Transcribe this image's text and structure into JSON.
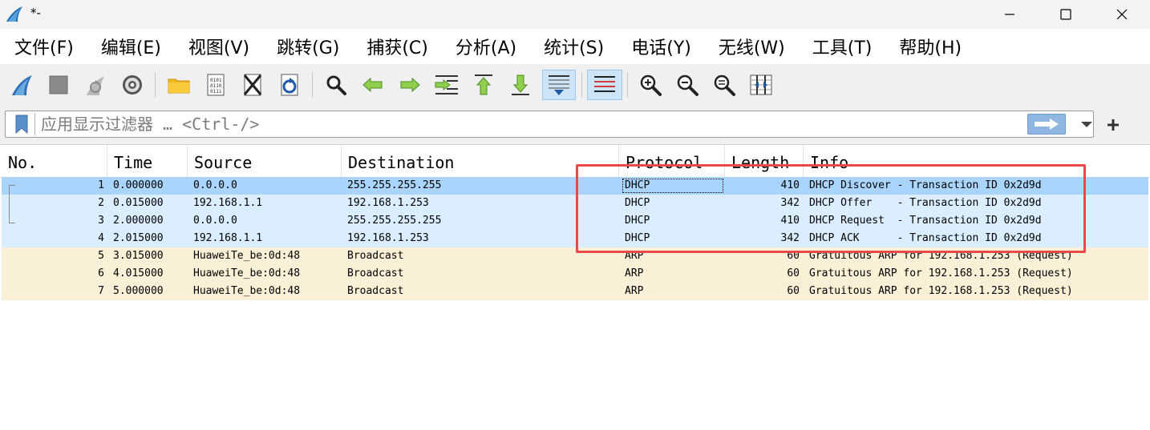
{
  "window": {
    "title": "*-"
  },
  "menu": [
    "文件(F)",
    "编辑(E)",
    "视图(V)",
    "跳转(G)",
    "捕获(C)",
    "分析(A)",
    "统计(S)",
    "电话(Y)",
    "无线(W)",
    "工具(T)",
    "帮助(H)"
  ],
  "toolbar": {
    "buttons": [
      "start-capture",
      "stop-capture",
      "restart-capture",
      "capture-options",
      "open-file",
      "save-file",
      "close-file",
      "reload-file",
      "find-packet",
      "go-back",
      "go-forward",
      "go-to-packet",
      "go-first",
      "go-last",
      "autoscroll",
      "colorize",
      "zoom-in",
      "zoom-out",
      "zoom-normal",
      "resize-columns"
    ]
  },
  "filter": {
    "placeholder": "应用显示过滤器 … <Ctrl-/>",
    "value": ""
  },
  "columns": [
    "No.",
    "Time",
    "Source",
    "Destination",
    "Protocol",
    "Length",
    "Info"
  ],
  "packets": [
    {
      "no": "1",
      "time": "0.000000",
      "source": "0.0.0.0",
      "destination": "255.255.255.255",
      "protocol": "DHCP",
      "length": "410",
      "info": "DHCP Discover - Transaction ID 0x2d9d"
    },
    {
      "no": "2",
      "time": "0.015000",
      "source": "192.168.1.1",
      "destination": "192.168.1.253",
      "protocol": "DHCP",
      "length": "342",
      "info": "DHCP Offer    - Transaction ID 0x2d9d"
    },
    {
      "no": "3",
      "time": "2.000000",
      "source": "0.0.0.0",
      "destination": "255.255.255.255",
      "protocol": "DHCP",
      "length": "410",
      "info": "DHCP Request  - Transaction ID 0x2d9d"
    },
    {
      "no": "4",
      "time": "2.015000",
      "source": "192.168.1.1",
      "destination": "192.168.1.253",
      "protocol": "DHCP",
      "length": "342",
      "info": "DHCP ACK      - Transaction ID 0x2d9d"
    },
    {
      "no": "5",
      "time": "3.015000",
      "source": "HuaweiTe_be:0d:48",
      "destination": "Broadcast",
      "protocol": "ARP",
      "length": "60",
      "info": "Gratuitous ARP for 192.168.1.253 (Request)"
    },
    {
      "no": "6",
      "time": "4.015000",
      "source": "HuaweiTe_be:0d:48",
      "destination": "Broadcast",
      "protocol": "ARP",
      "length": "60",
      "info": "Gratuitous ARP for 192.168.1.253 (Request)"
    },
    {
      "no": "7",
      "time": "5.000000",
      "source": "HuaweiTe_be:0d:48",
      "destination": "Broadcast",
      "protocol": "ARP",
      "length": "60",
      "info": "Gratuitous ARP for 192.168.1.253 (Request)"
    }
  ],
  "colors": {
    "selected_row": "#a9d4fb",
    "dhcp_row": "#daeeff",
    "arp_row": "#faf0d7",
    "highlight_box": "#e84a4a",
    "apply_button": "#8fb6e0"
  }
}
